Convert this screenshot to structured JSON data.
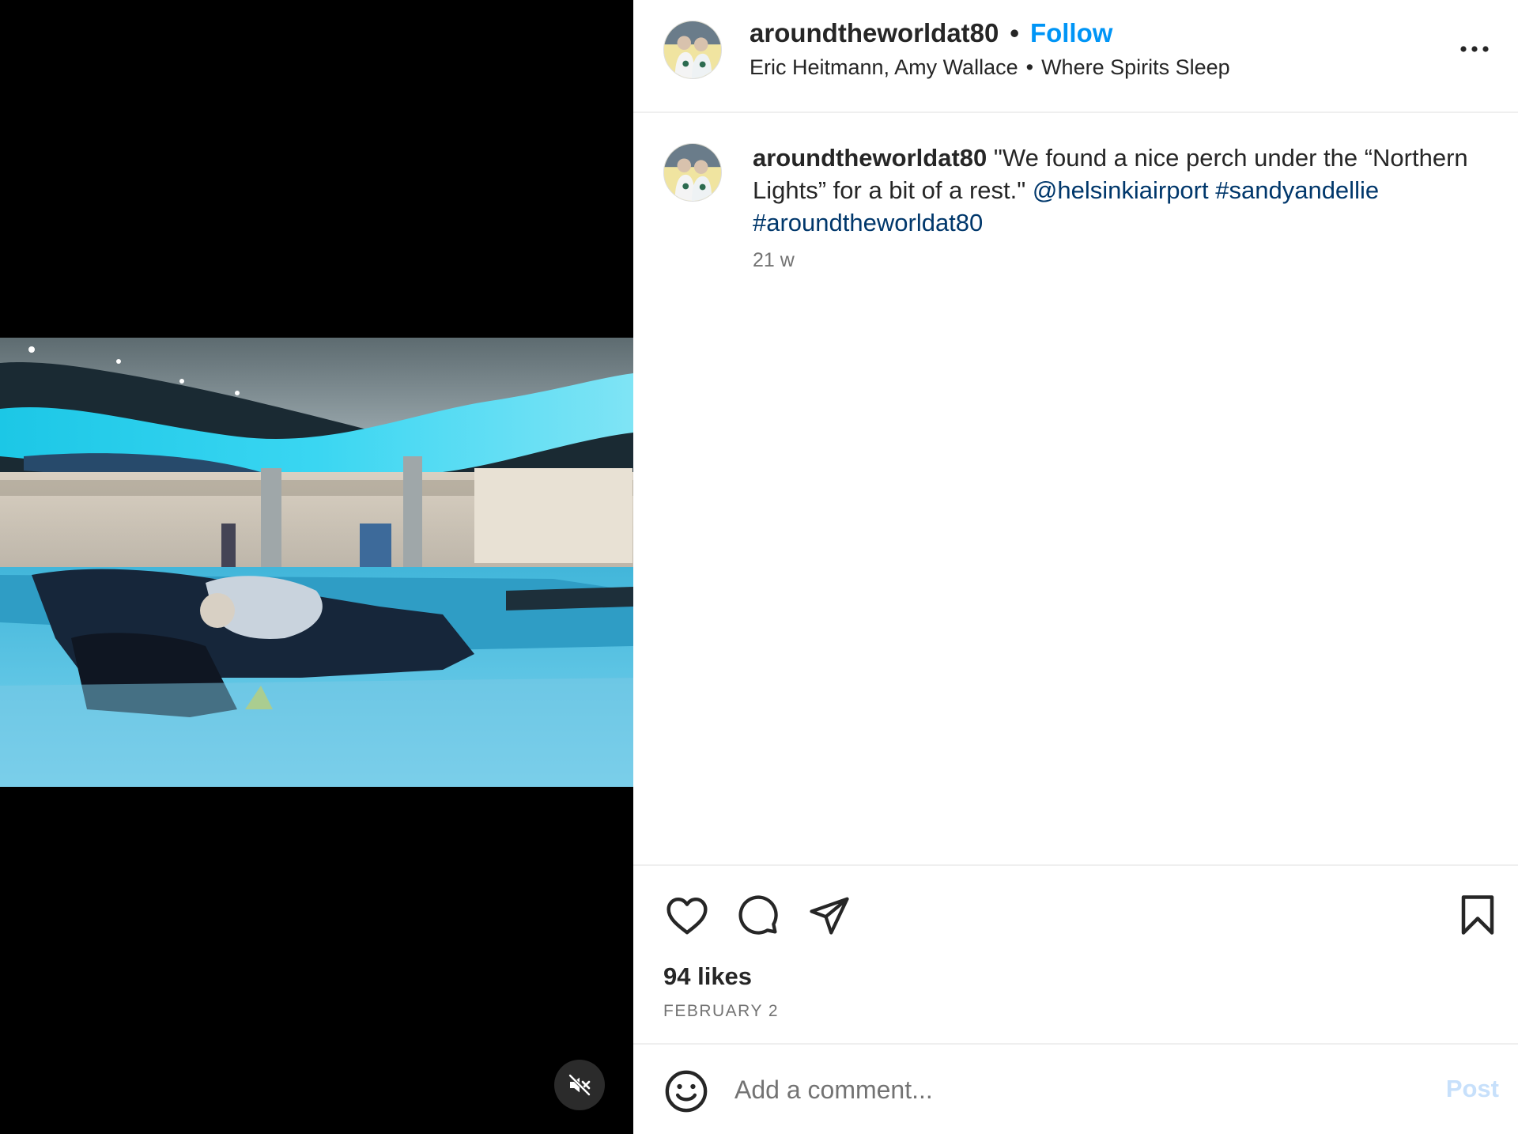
{
  "media": {
    "mute_icon": "speaker-muted-icon"
  },
  "header": {
    "username": "aroundtheworldat80",
    "separator": "•",
    "follow_label": "Follow",
    "collaborators": "Eric Heitmann, Amy Wallace",
    "audio_separator": "•",
    "audio": "Where Spirits Sleep",
    "more_icon": "more-options-icon"
  },
  "caption": {
    "username": "aroundtheworldat80",
    "text": " \"We found a nice perch under the “Northern Lights” for a bit of a rest.\" ",
    "mention": "@helsinkiairport",
    "hashtag1": "#sandyandellie",
    "hashtag2": "#aroundtheworldat80",
    "time": "21 w"
  },
  "actions": {
    "like_icon": "heart-icon",
    "comment_icon": "comment-icon",
    "share_icon": "share-icon",
    "save_icon": "bookmark-icon",
    "likes": "94 likes",
    "date": "FEBRUARY 2"
  },
  "comment": {
    "placeholder": "Add a comment...",
    "post_label": "Post"
  },
  "colors": {
    "follow": "#0095f6",
    "link": "#00376b",
    "post_disabled": "#c7e0fb",
    "muted_text": "#737373"
  }
}
